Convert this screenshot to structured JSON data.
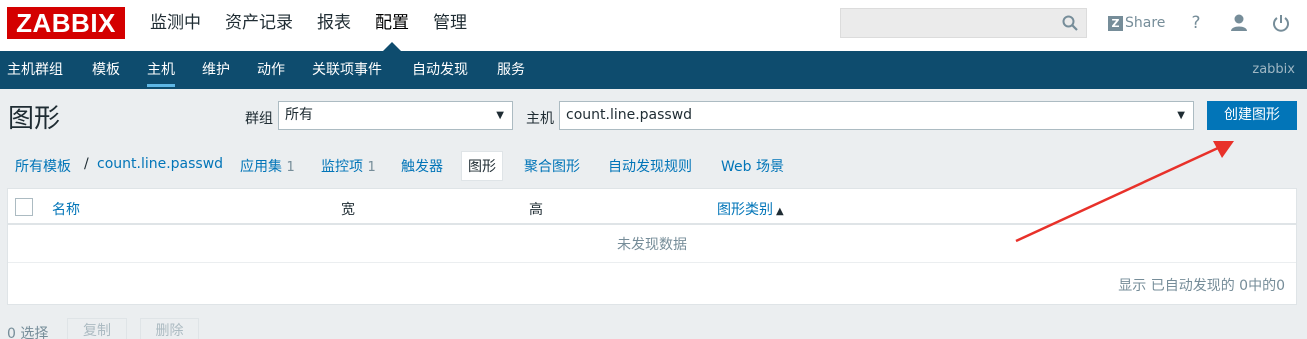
{
  "header": {
    "logo": "ZABBIX",
    "menu": [
      "监测中",
      "资产记录",
      "报表",
      "配置",
      "管理"
    ],
    "active_menu": "配置",
    "search_value": "",
    "share_label": "Share",
    "help_label": "?"
  },
  "submenu": {
    "items": [
      "主机群组",
      "模板",
      "主机",
      "维护",
      "动作",
      "关联项事件",
      "自动发现",
      "服务"
    ],
    "active": "主机",
    "user": "zabbix"
  },
  "page": {
    "title": "图形",
    "group_label": "群组",
    "group_value": "所有",
    "host_label": "主机",
    "host_value": "count.line.passwd",
    "create_button": "创建图形"
  },
  "tabs": {
    "all_templates": "所有模板",
    "separator": "/",
    "host": "count.line.passwd",
    "items": [
      {
        "label": "应用集",
        "count": "1"
      },
      {
        "label": "监控项",
        "count": "1"
      },
      {
        "label": "触发器",
        "count": ""
      },
      {
        "label": "图形",
        "count": ""
      },
      {
        "label": "聚合图形",
        "count": ""
      },
      {
        "label": "自动发现规则",
        "count": ""
      },
      {
        "label": "Web 场景",
        "count": ""
      }
    ],
    "current": "图形"
  },
  "table": {
    "columns": [
      "名称",
      "宽",
      "高",
      "图形类别"
    ],
    "sort_indicator": "▲",
    "empty_message": "未发现数据",
    "paging_text": "显示 已自动发现的 0中的0"
  },
  "footer": {
    "selected_text": "0 选择",
    "copy_button": "复制",
    "delete_button": "删除"
  },
  "colors": {
    "brand": "#d40000",
    "nav": "#0e4c6e",
    "link": "#0275b8",
    "annotation_arrow": "#e8312a"
  }
}
